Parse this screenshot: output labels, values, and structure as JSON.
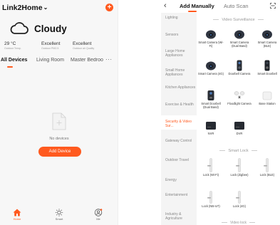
{
  "left": {
    "home_name": "Link2Home",
    "home_chevron": "chevron-down-icon",
    "add_icon": "plus-circle-icon",
    "weather": {
      "icon": "cloud-icon",
      "label": "Cloudy"
    },
    "stats": [
      {
        "value": "29 °C",
        "label": "Outdoor Temp."
      },
      {
        "value": "Excellent",
        "label": "Outdoor PM2.5"
      },
      {
        "value": "Excellent",
        "label": "Outdoor air Quality"
      }
    ],
    "tabs": [
      "All Devices",
      "Living Room",
      "Master Bedroo"
    ],
    "more_icon": "more-dots-icon",
    "empty_text": "No devices",
    "add_device_label": "Add Device",
    "nav": [
      {
        "label": "Home",
        "icon": "home-icon"
      },
      {
        "label": "Smart",
        "icon": "sun-icon"
      },
      {
        "label": "Me",
        "icon": "profile-icon"
      }
    ],
    "accent": "#ff5a1f"
  },
  "right": {
    "back_icon": "back-arrow-icon",
    "tabs": {
      "manual": "Add Manually",
      "auto": "Auto Scan"
    },
    "scan_icon": "scan-icon",
    "categories": [
      "Lighting",
      "Sensors",
      "Large Home Appliances",
      "Small Home Appliances",
      "Kitchen Appliances",
      "Exercise & Health",
      "Security & Video Sur...",
      "Gateway Control",
      "Outdoor Travel",
      "Energy",
      "Entertainment",
      "Industry & Agriculture"
    ],
    "active_category": "Security & Video Sur...",
    "sections": {
      "video": "Video Surveillance",
      "lock": "Smart Lock",
      "video_lock": "Video lock"
    },
    "video_devices": [
      "Smart Camera (Wi-Fi)",
      "Smart Camera (Dual Band)",
      "Smart Camera (BLE)",
      "Smart Camera (4G)",
      "Doorbell Camera",
      "Smart Doorbell",
      "Smart Doorbell (Dual Band)",
      "Floodlight Camera",
      "Base Station",
      "NVR",
      "DVR"
    ],
    "lock_devices": [
      "Lock (Wi-Fi)",
      "Lock (Zigbee)",
      "Lock (BLE)",
      "Lock (NB-IoT)",
      "Lock (4G)"
    ]
  }
}
